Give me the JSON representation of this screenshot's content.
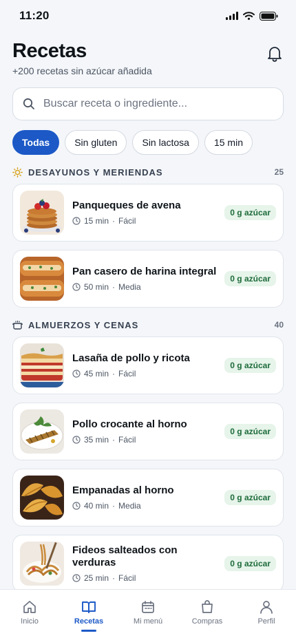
{
  "status": {
    "time": "11:20"
  },
  "header": {
    "title": "Recetas",
    "subtitle": "+200 recetas sin azúcar añadida"
  },
  "search": {
    "placeholder": "Buscar receta o ingrediente..."
  },
  "chips": [
    "Todas",
    "Sin gluten",
    "Sin lactosa",
    "15 min"
  ],
  "sections": [
    {
      "title": "DESAYUNOS Y MERIENDAS",
      "count": "25",
      "recipes": [
        {
          "title": "Panqueques de avena",
          "time": "15 min",
          "difficulty": "Fácil",
          "badge": "0 g azúcar"
        },
        {
          "title": "Pan casero de harina integral",
          "time": "50 min",
          "difficulty": "Media",
          "badge": "0 g azúcar"
        }
      ]
    },
    {
      "title": "ALMUERZOS Y CENAS",
      "count": "40",
      "recipes": [
        {
          "title": "Lasaña de pollo y ricota",
          "time": "45 min",
          "difficulty": "Fácil",
          "badge": "0 g azúcar"
        },
        {
          "title": "Pollo crocante al horno",
          "time": "35 min",
          "difficulty": "Fácil",
          "badge": "0 g azúcar"
        },
        {
          "title": "Empanadas al horno",
          "time": "40 min",
          "difficulty": "Media",
          "badge": "0 g azúcar"
        },
        {
          "title": "Fideos salteados con verduras",
          "time": "25 min",
          "difficulty": "Fácil",
          "badge": "0 g azúcar"
        }
      ]
    }
  ],
  "meta_separator": " · ",
  "tabs": [
    {
      "label": "Inicio",
      "icon": "home-icon"
    },
    {
      "label": "Recetas",
      "icon": "book-icon"
    },
    {
      "label": "Mi menú",
      "icon": "calendar-icon"
    },
    {
      "label": "Compras",
      "icon": "bag-icon"
    },
    {
      "label": "Perfil",
      "icon": "user-icon"
    }
  ],
  "colors": {
    "accent": "#1c59c7",
    "badge_bg": "#e6f4ea",
    "badge_text": "#1e6b3a",
    "background": "#f4f6f9"
  }
}
